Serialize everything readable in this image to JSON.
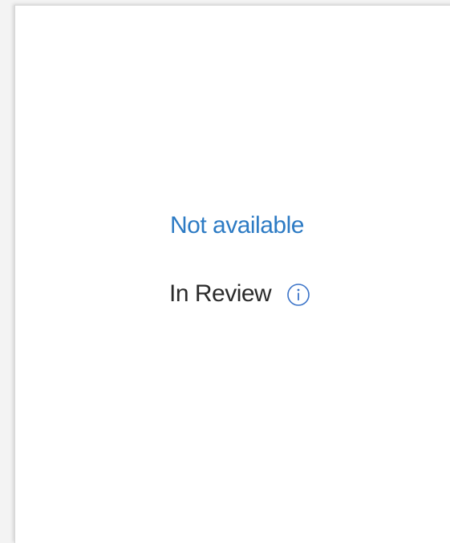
{
  "status": {
    "availability_label": "Not available",
    "review_label": "In Review",
    "info_icon": "info-circle-icon"
  },
  "colors": {
    "link": "#2d7bc4",
    "text": "#2b2b2b",
    "icon": "#3a73c8"
  }
}
